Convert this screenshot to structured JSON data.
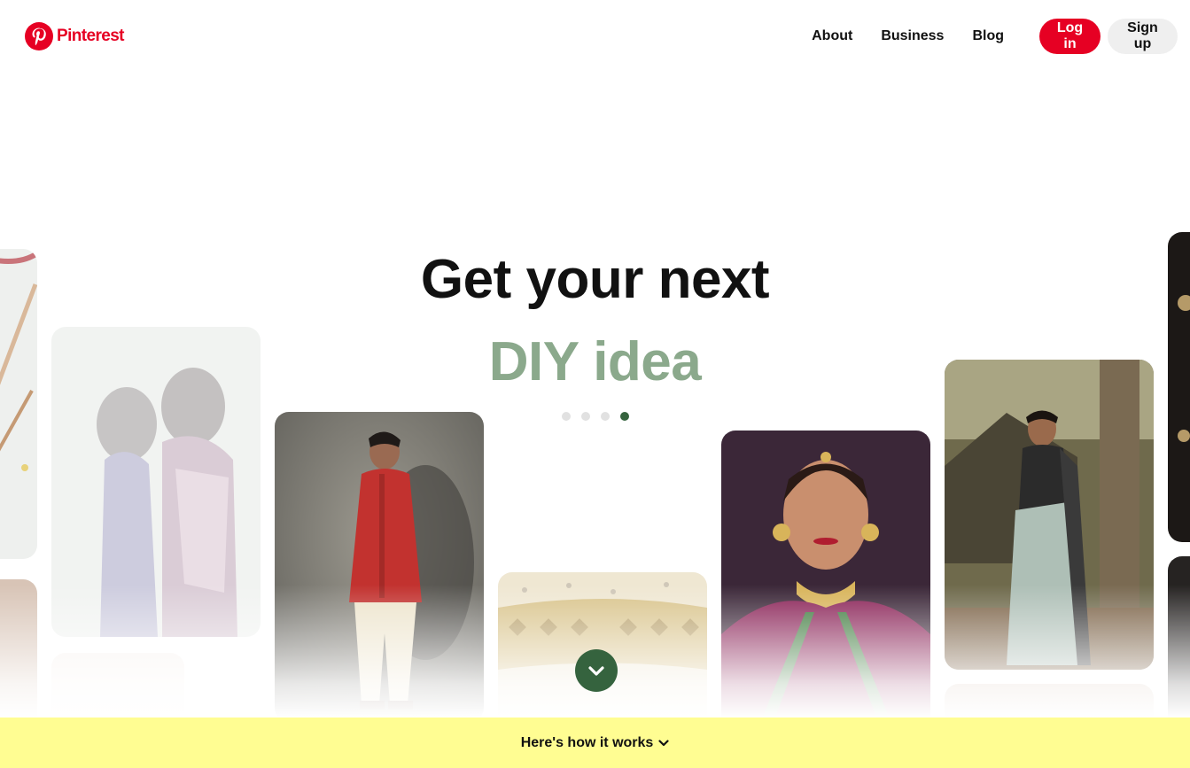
{
  "header": {
    "brand": "Pinterest",
    "nav": {
      "about": "About",
      "business": "Business",
      "blog": "Blog"
    },
    "login_label": "Log in",
    "signup_label": "Sign up"
  },
  "hero": {
    "line1": "Get your next",
    "line2": "DIY idea",
    "slides_count": 4,
    "active_slide": 4
  },
  "banner": {
    "label": "Here's how it works"
  },
  "colors": {
    "brand_red": "#e60023",
    "accent_green": "#35633e",
    "headline_green": "#8ba98c",
    "banner_yellow": "#fffd92"
  },
  "icons": {
    "logo": "pinterest-logo-icon",
    "scroll": "chevron-down-icon",
    "banner": "chevron-down-icon"
  }
}
